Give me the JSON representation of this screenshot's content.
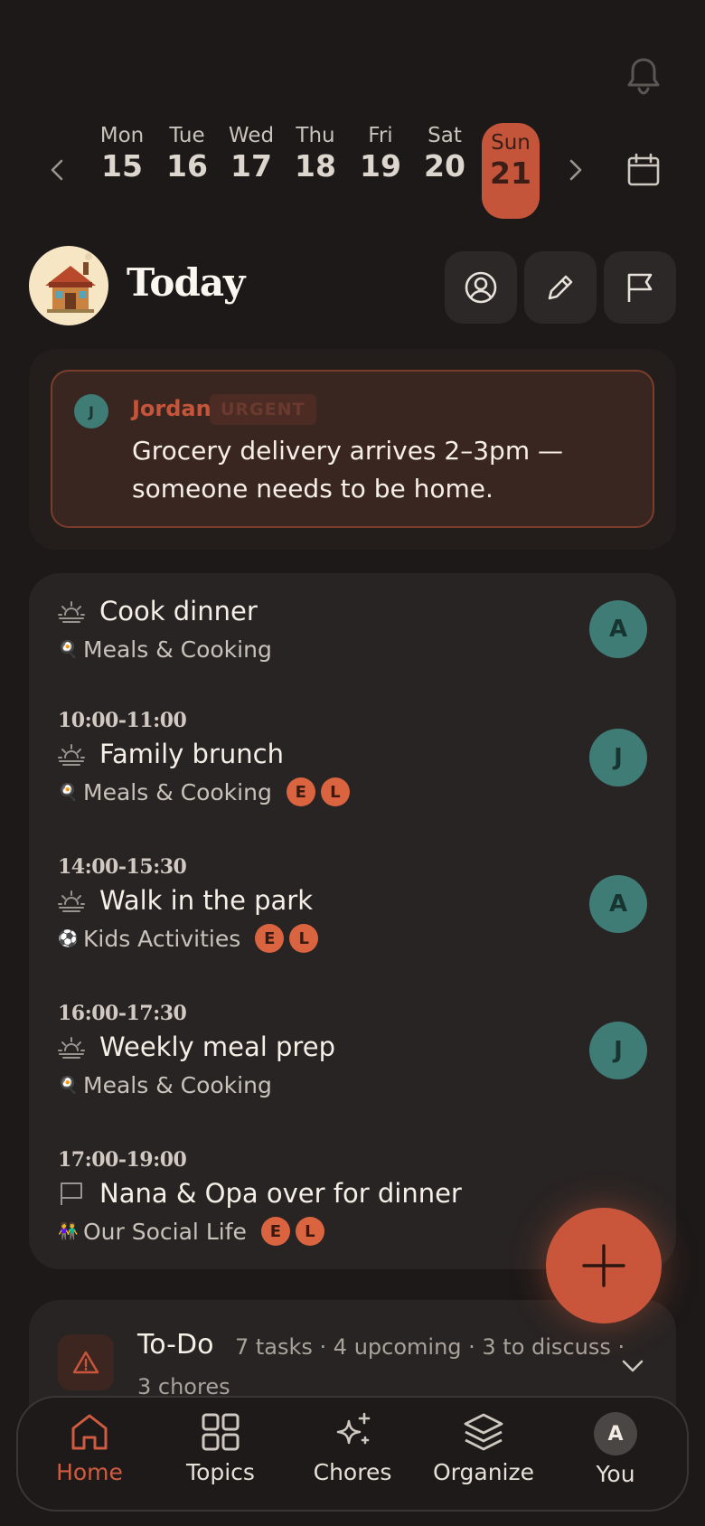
{
  "week": {
    "days": [
      {
        "name": "Mon",
        "date": "15"
      },
      {
        "name": "Tue",
        "date": "16"
      },
      {
        "name": "Wed",
        "date": "17"
      },
      {
        "name": "Thu",
        "date": "18"
      },
      {
        "name": "Fri",
        "date": "19"
      },
      {
        "name": "Sat",
        "date": "20"
      },
      {
        "name": "Sun",
        "date": "21"
      }
    ],
    "selected_index": 6
  },
  "header": {
    "title": "Today"
  },
  "urgent": {
    "avatar_initial": "J",
    "author": "Jordan",
    "badge": "URGENT",
    "message": "Grocery delivery arrives 2–3pm — someone needs to be home."
  },
  "events": [
    {
      "time": "",
      "title": "Cook dinner",
      "emoji": "🍳",
      "category": "Meals & Cooking",
      "chips": [],
      "assignee": "A",
      "icon": "sunrise-icon"
    },
    {
      "time": "10:00-11:00",
      "title": "Family brunch",
      "emoji": "🍳",
      "category": "Meals & Cooking",
      "chips": [
        "E",
        "L"
      ],
      "assignee": "J",
      "icon": "sunrise-icon"
    },
    {
      "time": "14:00-15:30",
      "title": "Walk in the park",
      "emoji": "⚽",
      "category": "Kids Activities",
      "chips": [
        "E",
        "L"
      ],
      "assignee": "A",
      "icon": "sunrise-icon"
    },
    {
      "time": "16:00-17:30",
      "title": "Weekly meal prep",
      "emoji": "🍳",
      "category": "Meals & Cooking",
      "chips": [],
      "assignee": "J",
      "icon": "sunrise-icon"
    },
    {
      "time": "17:00-19:00",
      "title": "Nana & Opa over for dinner",
      "emoji": "👫",
      "category": "Our Social Life",
      "chips": [
        "E",
        "L"
      ],
      "assignee": "",
      "icon": "flag-icon"
    }
  ],
  "todo": {
    "title": "To-Do",
    "summary": "7 tasks · 4 upcoming · 3 to discuss ·",
    "summary_cont": "3 chores"
  },
  "nav": {
    "tabs": [
      {
        "label": "Home",
        "icon": "home-icon"
      },
      {
        "label": "Topics",
        "icon": "grid-icon"
      },
      {
        "label": "Chores",
        "icon": "sparkle-icon"
      },
      {
        "label": "Organize",
        "icon": "layers-icon"
      },
      {
        "label": "You",
        "icon": "avatar"
      }
    ],
    "active_index": 0,
    "you_initial": "A"
  },
  "colors": {
    "accent": "#c5553a",
    "teal": "#3f7c76",
    "background": "#1c1918",
    "card": "#282423"
  }
}
